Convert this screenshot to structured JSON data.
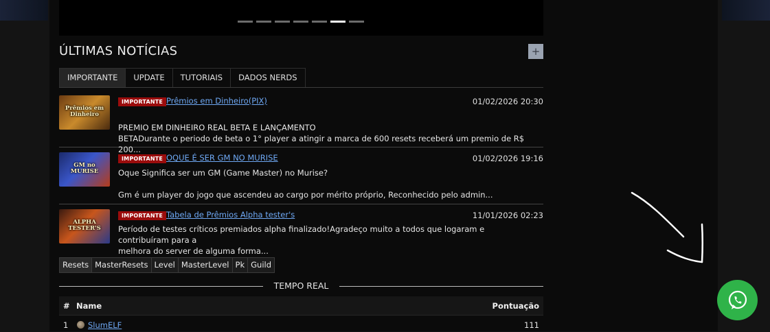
{
  "slider": {
    "dots": 7,
    "active_index": 5
  },
  "news_section": {
    "title": "ÚLTIMAS NOTÍCIAS",
    "add_label": "+",
    "tabs": [
      "IMPORTANTE",
      "UPDATE",
      "TUTORIAIS",
      "DADOS NERDS"
    ],
    "active_tab": "IMPORTANTE",
    "items": [
      {
        "thumb_text": "Prêmios em Dinheiro",
        "badge": "IMPORTANTE",
        "title": "Prêmios em Dinheiro(PIX)",
        "date": "01/02/2026 20:30",
        "lines": [
          "PREMIO EM DINHEIRO REAL BETA E LANÇAMENTO",
          "BETADurante o periodo de beta o 1° player a atingir a marca de 600 resets receberá um premio de R$ 200..."
        ]
      },
      {
        "thumb_text": "GM no MURISE",
        "badge": "IMPORTANTE",
        "title": "OQUE É SER GM NO MURISE",
        "date": "01/02/2026 19:16",
        "lines": [
          "Oque Significa ser um GM (Game Master) no Murise?",
          "",
          "Gm é um player do jogo que ascendeu ao cargo por mérito próprio, Reconhecido pelo admin..."
        ]
      },
      {
        "thumb_text": "ALPHA TESTER'S",
        "badge": "IMPORTANTE",
        "title": "Tabela de Prêmios Alpha tester's",
        "date": "11/01/2026 02:23",
        "lines": [
          "Período de testes críticos premiados alpha finalizado!Agradeço muito a todos que logaram e contribuíram para a",
          "melhora do server de alguma forma..."
        ]
      }
    ]
  },
  "ranking": {
    "tabs": [
      "Resets",
      "MasterResets",
      "Level",
      "MasterLevel",
      "Pk",
      "Guild"
    ],
    "active_tab": "Resets",
    "subtitle": "TEMPO REAL",
    "columns": {
      "rank": "#",
      "name": "Name",
      "score": "Pontuação"
    },
    "rows": [
      {
        "rank": "1",
        "name": "SlumELF",
        "score": "111"
      }
    ]
  },
  "colors": {
    "accent_link": "#6fa9f5",
    "badge_red": "#9b0c0c",
    "whatsapp_green": "#2fb349"
  },
  "icons": {
    "floating_button": "whatsapp-icon",
    "pointer": "hand-drawn-arrow"
  }
}
